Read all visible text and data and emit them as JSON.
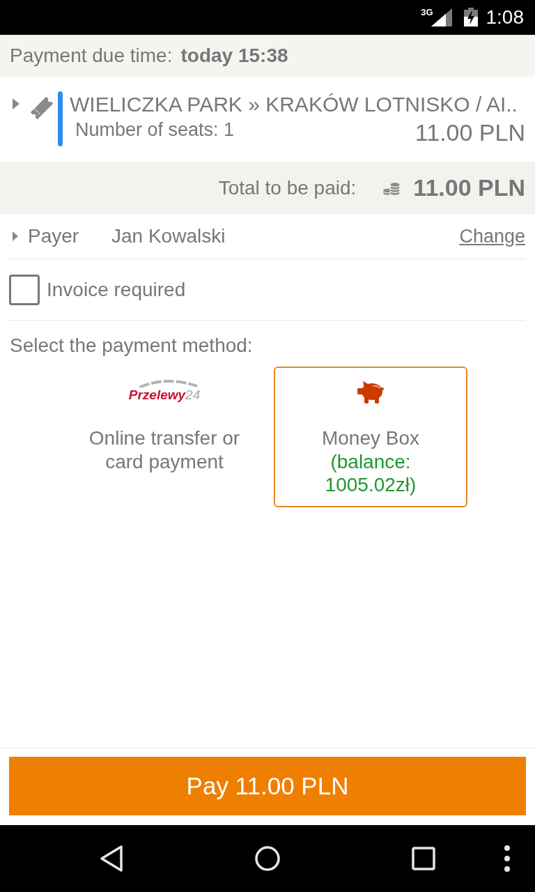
{
  "status_bar": {
    "network": "3G",
    "time": "1:08"
  },
  "due": {
    "label": "Payment due time:",
    "value": "today 15:38"
  },
  "trip": {
    "expanded": false,
    "route": "WIELICZKA PARK » KRAKÓW LOTNISKO / AI..",
    "seats": "Number of seats: 1",
    "price": "11.00 PLN"
  },
  "total": {
    "label": "Total to be paid:",
    "amount": "11.00 PLN"
  },
  "payer": {
    "expanded": false,
    "label": "Payer",
    "name": "Jan Kowalski",
    "link": "Change"
  },
  "invoice": {
    "label": "Invoice required",
    "checked": false
  },
  "payment": {
    "title": "Select the payment method:",
    "methods": [
      {
        "kind": "przelewy24",
        "logo": "Przelewy",
        "logo_suffix": "24",
        "label": "Online transfer or card payment",
        "selected": false
      },
      {
        "kind": "moneybox",
        "label": "Money Box",
        "balance": "(balance: 1005.02zł)",
        "selected": true
      }
    ]
  },
  "pay_button": {
    "label": "Pay 11.00 PLN"
  }
}
